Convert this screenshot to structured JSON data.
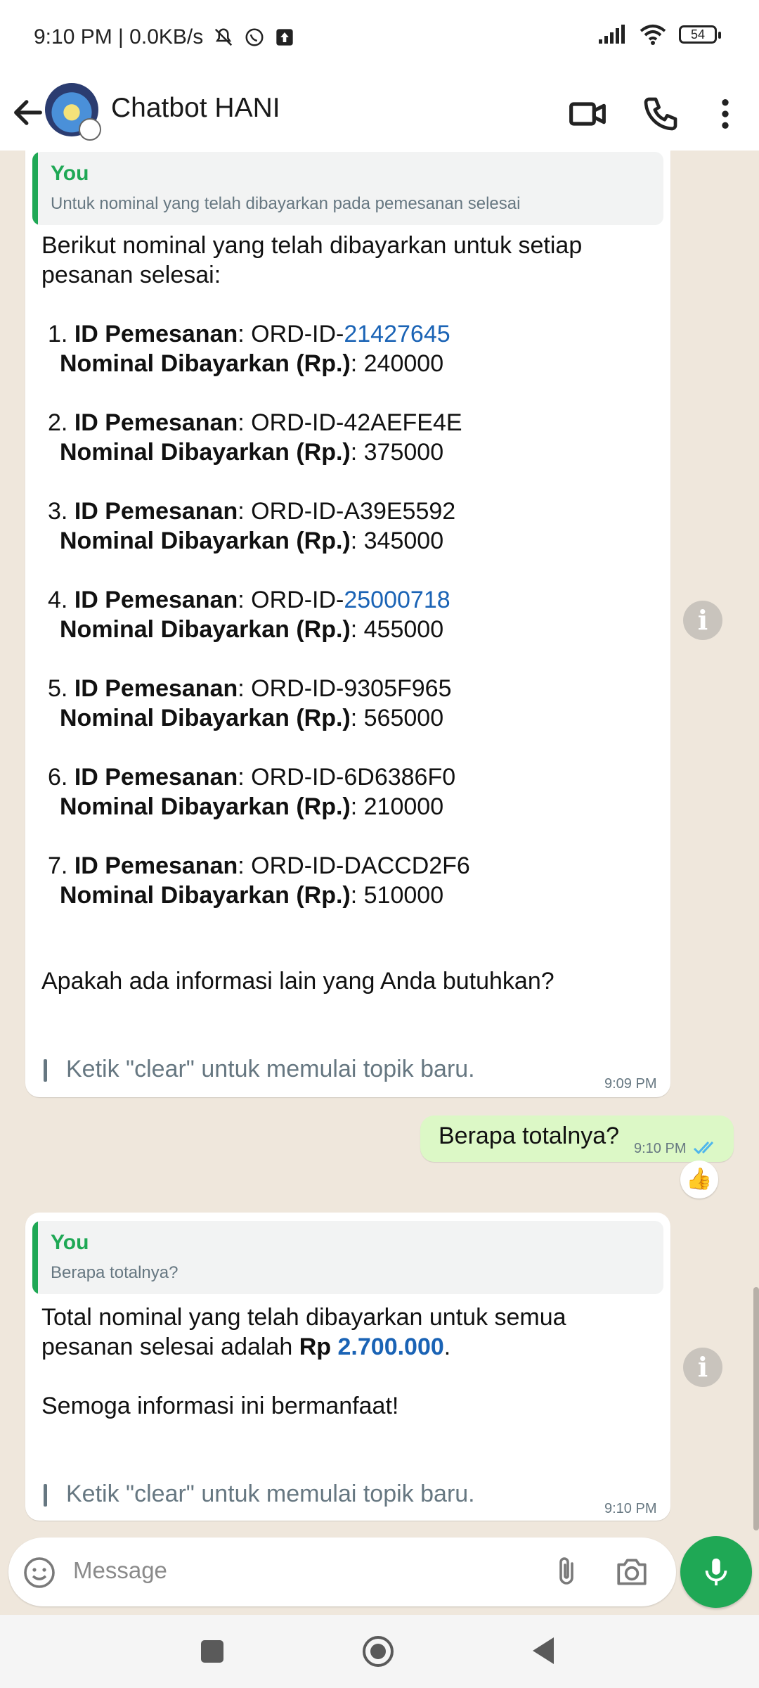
{
  "status_bar": {
    "time_speed": "9:10 PM | 0.0KB/s",
    "battery": "54"
  },
  "header": {
    "title": "Chatbot HANI"
  },
  "messages": {
    "bot1": {
      "quote_name": "You",
      "quote_text": "Untuk nominal yang telah dibayarkan pada pemesanan selesai",
      "intro_line1": "Berikut nominal yang telah dibayarkan untuk setiap",
      "intro_line2": "pesanan selesai:",
      "id_label": "ID Pemesanan",
      "nominal_label": "Nominal Dibayarkan (Rp.)",
      "id_prefix": "ORD-ID-",
      "items": [
        {
          "num": "1.",
          "id": "21427645",
          "linked": true,
          "amount": "240000"
        },
        {
          "num": "2.",
          "id": "42AEFE4E",
          "linked": false,
          "amount": "375000"
        },
        {
          "num": "3.",
          "id": "A39E5592",
          "linked": false,
          "amount": "345000"
        },
        {
          "num": "4.",
          "id": "25000718",
          "linked": true,
          "amount": "455000"
        },
        {
          "num": "5.",
          "id": "9305F965",
          "linked": false,
          "amount": "565000"
        },
        {
          "num": "6.",
          "id": "6D6386F0",
          "linked": false,
          "amount": "210000"
        },
        {
          "num": "7.",
          "id": "DACCD2F6",
          "linked": false,
          "amount": "510000"
        }
      ],
      "question": "Apakah ada informasi lain yang Anda butuhkan?",
      "hint": "Ketik \"clear\" untuk memulai topik baru.",
      "time": "9:09 PM"
    },
    "user1": {
      "text": "Berapa totalnya?",
      "time": "9:10 PM",
      "reaction": "👍"
    },
    "bot2": {
      "quote_name": "You",
      "quote_text": "Berapa totalnya?",
      "line1": "Total nominal yang telah dibayarkan untuk semua",
      "line2_prefix": "pesanan selesai adalah ",
      "line2_bold": "Rp",
      "line2_amount": "2.700.000",
      "line2_suffix": ".",
      "line3": "Semoga informasi ini bermanfaat!",
      "hint": "Ketik \"clear\" untuk memulai topik baru.",
      "time": "9:10 PM"
    }
  },
  "input": {
    "placeholder": "Message"
  },
  "colors": {
    "accent": "#1fa855",
    "link": "#1a63b5",
    "sent_bubble": "#dcf8c6",
    "chat_bg": "#efe7dc"
  }
}
